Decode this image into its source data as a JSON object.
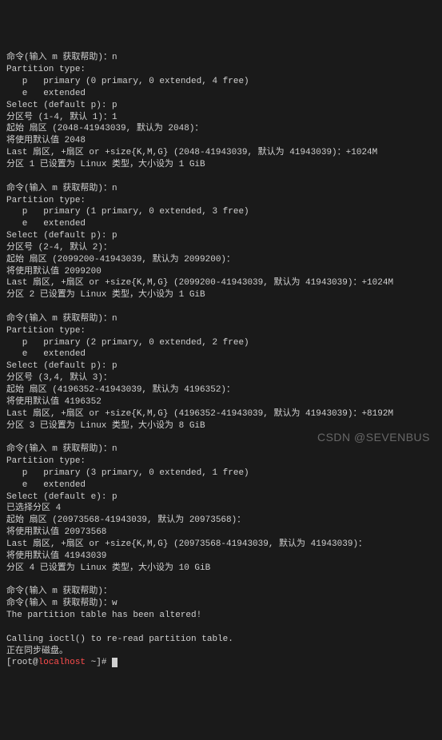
{
  "lines": [
    "命令(输入 m 获取帮助)：n",
    "Partition type:",
    "   p   primary (0 primary, 0 extended, 4 free)",
    "   e   extended",
    "Select (default p): p",
    "分区号 (1-4, 默认 1)：1",
    "起始 扇区 (2048-41943039, 默认为 2048)：",
    "将使用默认值 2048",
    "Last 扇区, +扇区 or +size{K,M,G} (2048-41943039, 默认为 41943039)：+1024M",
    "分区 1 已设置为 Linux 类型，大小设为 1 GiB",
    "",
    "命令(输入 m 获取帮助)：n",
    "Partition type:",
    "   p   primary (1 primary, 0 extended, 3 free)",
    "   e   extended",
    "Select (default p): p",
    "分区号 (2-4, 默认 2)：",
    "起始 扇区 (2099200-41943039, 默认为 2099200)：",
    "将使用默认值 2099200",
    "Last 扇区, +扇区 or +size{K,M,G} (2099200-41943039, 默认为 41943039)：+1024M",
    "分区 2 已设置为 Linux 类型，大小设为 1 GiB",
    "",
    "命令(输入 m 获取帮助)：n",
    "Partition type:",
    "   p   primary (2 primary, 0 extended, 2 free)",
    "   e   extended",
    "Select (default p): p",
    "分区号 (3,4, 默认 3)：",
    "起始 扇区 (4196352-41943039, 默认为 4196352)：",
    "将使用默认值 4196352",
    "Last 扇区, +扇区 or +size{K,M,G} (4196352-41943039, 默认为 41943039)：+8192M",
    "分区 3 已设置为 Linux 类型，大小设为 8 GiB",
    "",
    "命令(输入 m 获取帮助)：n",
    "Partition type:",
    "   p   primary (3 primary, 0 extended, 1 free)",
    "   e   extended",
    "Select (default e): p",
    "已选择分区 4",
    "起始 扇区 (20973568-41943039, 默认为 20973568)：",
    "将使用默认值 20973568",
    "Last 扇区, +扇区 or +size{K,M,G} (20973568-41943039, 默认为 41943039)：",
    "将使用默认值 41943039",
    "分区 4 已设置为 Linux 类型，大小设为 10 GiB",
    "",
    "命令(输入 m 获取帮助)：",
    "命令(输入 m 获取帮助)：w",
    "The partition table has been altered!",
    "",
    "Calling ioctl() to re-read partition table.",
    "正在同步磁盘。"
  ],
  "prompt": {
    "user": "root",
    "at": "@",
    "host": "localhost",
    "suffix": " ~]# "
  },
  "watermark": "CSDN @SEVENBUS"
}
